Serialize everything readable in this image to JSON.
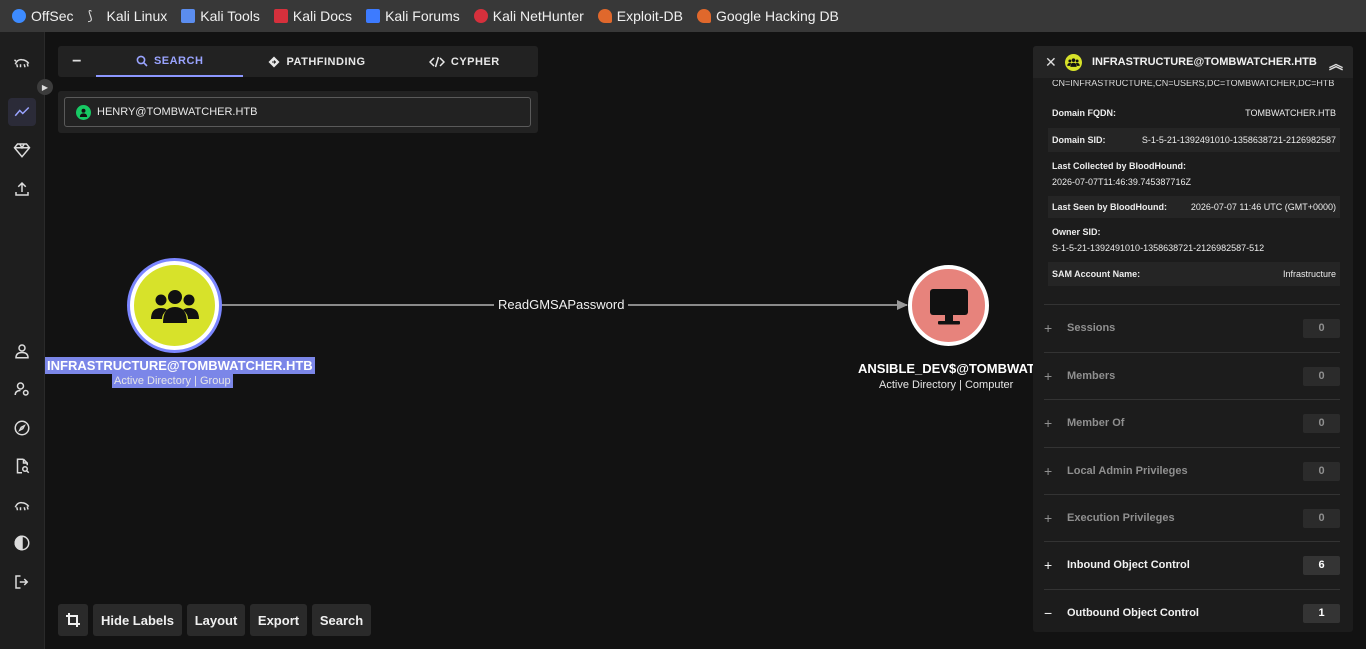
{
  "bookmarks": [
    {
      "label": "OffSec",
      "icon": "offsec-icon",
      "color": "#3d8bff"
    },
    {
      "label": "Kali Linux",
      "icon": "kali-dragon-icon",
      "color": "#dddddd"
    },
    {
      "label": "Kali Tools",
      "icon": "kali-tools-icon",
      "color": "#5b8def"
    },
    {
      "label": "Kali Docs",
      "icon": "kali-docs-icon",
      "color": "#d6303c"
    },
    {
      "label": "Kali Forums",
      "icon": "kali-forums-icon",
      "color": "#3d7bff"
    },
    {
      "label": "Kali NetHunter",
      "icon": "nethunter-icon",
      "color": "#d6303c"
    },
    {
      "label": "Exploit-DB",
      "icon": "exploit-db-icon",
      "color": "#e0682c"
    },
    {
      "label": "Google Hacking DB",
      "icon": "ghdb-icon",
      "color": "#e0682c"
    }
  ],
  "search_panel": {
    "tabs": [
      {
        "label": "SEARCH",
        "icon": "search-icon",
        "active": true
      },
      {
        "label": "PATHFINDING",
        "icon": "diamond-icon",
        "active": false
      },
      {
        "label": "CYPHER",
        "icon": "code-icon",
        "active": false
      }
    ],
    "collapse_label": "−",
    "query": "HENRY@TOMBWATCHER.HTB"
  },
  "graph": {
    "source": {
      "title": "INFRASTRUCTURE@TOMBWATCHER.HTB",
      "subtitle": "Active Directory | Group",
      "icon": "group-icon",
      "color": "#d7e22a"
    },
    "target": {
      "title": "ANSIBLE_DEV$@TOMBWAT...",
      "subtitle": "Active Directory | Computer",
      "icon": "computer-icon",
      "color": "#e7837c"
    },
    "edge_label": "ReadGMSAPassword",
    "accent": "#7b86e8"
  },
  "controls": {
    "crop_icon": "crop-icon",
    "hide_labels": "Hide Labels",
    "layout": "Layout",
    "export": "Export",
    "search": "Search"
  },
  "entity_panel": {
    "title": "INFRASTRUCTURE@TOMBWATCHER.HTB",
    "close_icon": "close-icon",
    "collapse_icon": "chevron-up-icon",
    "dn_partial": "CN=INFRASTRUCTURE,CN=USERS,DC=TOMBWATCHER,DC=HTB",
    "properties": [
      {
        "label": "Domain FQDN:",
        "value": "TOMBWATCHER.HTB"
      },
      {
        "label": "Domain SID:",
        "value": "S-1-5-21-1392491010-1358638721-2126982587"
      },
      {
        "label": "Last Collected by BloodHound:",
        "value": "2026-07-07T11:46:39.745387716Z"
      },
      {
        "label": "Last Seen by BloodHound:",
        "value": "2026-07-07 11:46 UTC (GMT+0000)"
      },
      {
        "label": "Owner SID:",
        "value": "S-1-5-21-1392491010-1358638721-2126982587-512"
      },
      {
        "label": "SAM Account Name:",
        "value": "Infrastructure"
      }
    ],
    "sections": [
      {
        "label": "Sessions",
        "count": "0",
        "sign": "+"
      },
      {
        "label": "Members",
        "count": "0",
        "sign": "+"
      },
      {
        "label": "Member Of",
        "count": "0",
        "sign": "+"
      },
      {
        "label": "Local Admin Privileges",
        "count": "0",
        "sign": "+"
      },
      {
        "label": "Execution Privileges",
        "count": "0",
        "sign": "+"
      },
      {
        "label": "Inbound Object Control",
        "count": "6",
        "sign": "+"
      },
      {
        "label": "Outbound Object Control",
        "count": "1",
        "sign": "−"
      }
    ]
  }
}
